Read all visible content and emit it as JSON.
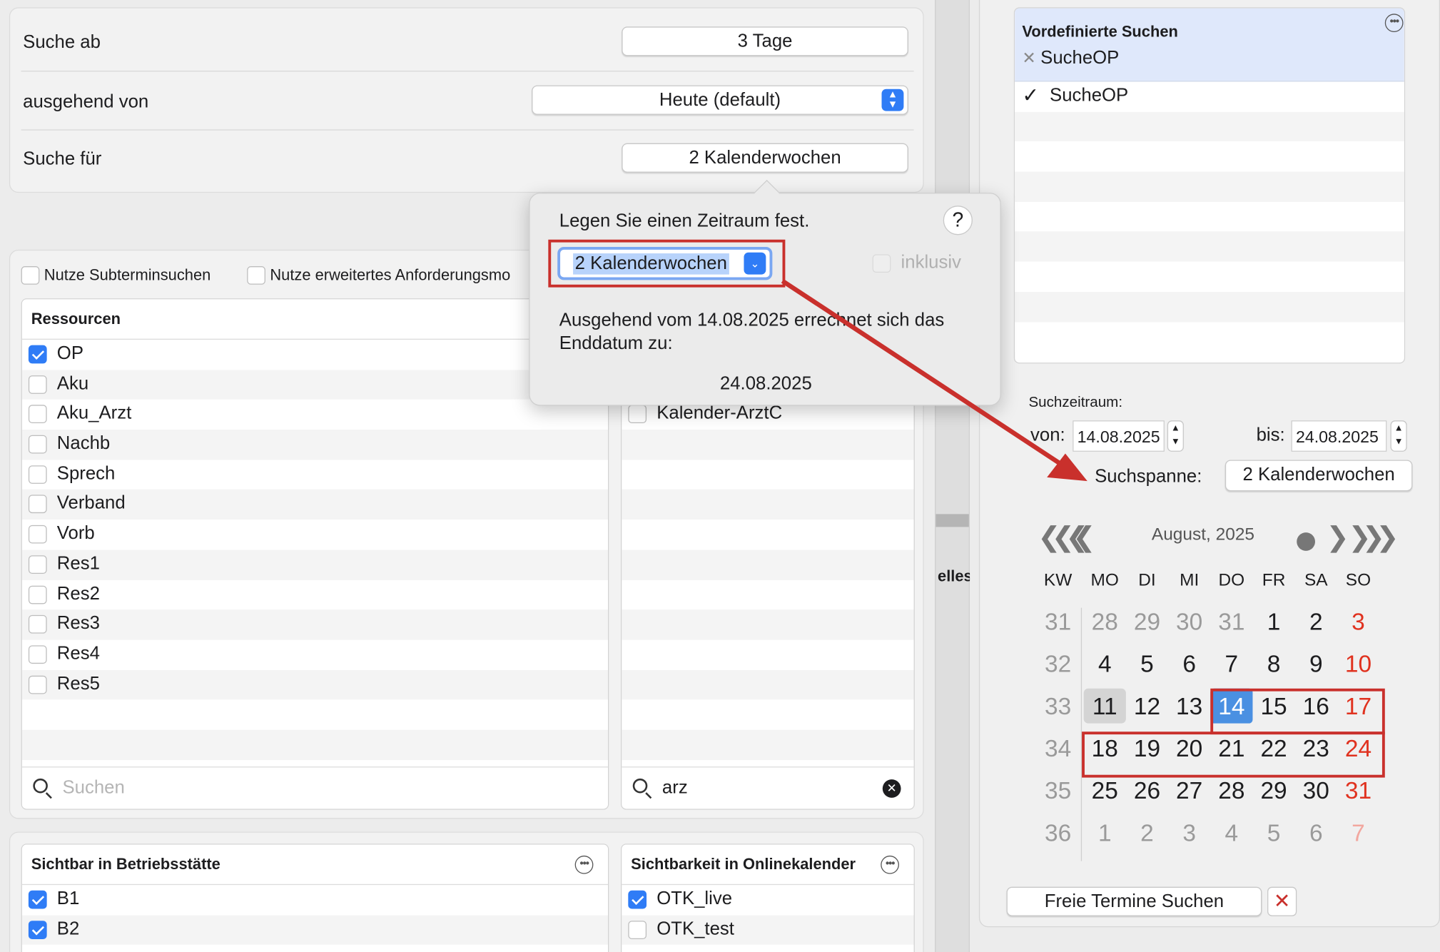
{
  "search_settings": {
    "search_from_label": "Suche ab",
    "search_from_value": "3 Tage",
    "based_on_label": "ausgehend von",
    "based_on_value": "Heute (default)",
    "search_for_label": "Suche für",
    "search_for_value": "2 Kalenderwochen"
  },
  "options": {
    "use_subterm": "Nutze Subterminsuchen",
    "use_extended": "Nutze erweitertes Anforderungsmo"
  },
  "resources": {
    "header": "Ressourcen",
    "items": [
      {
        "label": "OP",
        "checked": true
      },
      {
        "label": "Aku",
        "checked": false
      },
      {
        "label": "Aku_Arzt",
        "checked": false
      },
      {
        "label": "Nachb",
        "checked": false
      },
      {
        "label": "Sprech",
        "checked": false
      },
      {
        "label": "Verband",
        "checked": false
      },
      {
        "label": "Vorb",
        "checked": false
      },
      {
        "label": "Res1",
        "checked": false
      },
      {
        "label": "Res2",
        "checked": false
      },
      {
        "label": "Res3",
        "checked": false
      },
      {
        "label": "Res4",
        "checked": false
      },
      {
        "label": "Res5",
        "checked": false
      }
    ],
    "search_placeholder": "Suchen"
  },
  "second_list": {
    "visible_item": "Kalender-ArztC",
    "search_value": "arz"
  },
  "popover": {
    "title": "Legen Sie einen Zeitraum fest.",
    "help": "?",
    "selected": "2 Kalenderwochen",
    "inclusive": "inklusiv",
    "description": "Ausgehend vom 14.08.2025 errechnet sich das Enddatum zu:",
    "end_date": "24.08.2025"
  },
  "visible_in_site": {
    "header": "Sichtbar in Betriebsstätte",
    "items": [
      {
        "label": "B1",
        "checked": true
      },
      {
        "label": "B2",
        "checked": true
      }
    ]
  },
  "online_calendar": {
    "header": "Sichtbarkeit in Onlinekalender",
    "items": [
      {
        "label": "OTK_live",
        "checked": true
      },
      {
        "label": "OTK_test",
        "checked": false
      }
    ]
  },
  "partial_label": "elles",
  "predefined": {
    "header": "Vordefinierte Suchen",
    "active": "SucheOP",
    "items": [
      {
        "label": "SucheOP",
        "checked": true
      }
    ]
  },
  "timeframe": {
    "label": "Suchzeitraum:",
    "from_label": "von:",
    "from_value": "14.08.2025",
    "to_label": "bis:",
    "to_value": "24.08.2025",
    "span_label": "Suchspanne:",
    "span_value": "2 Kalenderwochen"
  },
  "calendar": {
    "month": "August, 2025",
    "headers": [
      "KW",
      "MO",
      "DI",
      "MI",
      "DO",
      "FR",
      "SA",
      "SO"
    ],
    "weeks": [
      {
        "kw": "31",
        "days": [
          "28",
          "29",
          "30",
          "31",
          "1",
          "2",
          "3"
        ]
      },
      {
        "kw": "32",
        "days": [
          "4",
          "5",
          "6",
          "7",
          "8",
          "9",
          "10"
        ]
      },
      {
        "kw": "33",
        "days": [
          "11",
          "12",
          "13",
          "14",
          "15",
          "16",
          "17"
        ]
      },
      {
        "kw": "34",
        "days": [
          "18",
          "19",
          "20",
          "21",
          "22",
          "23",
          "24"
        ]
      },
      {
        "kw": "35",
        "days": [
          "25",
          "26",
          "27",
          "28",
          "29",
          "30",
          "31"
        ]
      },
      {
        "kw": "36",
        "days": [
          "1",
          "2",
          "3",
          "4",
          "5",
          "6",
          "7"
        ]
      }
    ]
  },
  "actions": {
    "search_button": "Freie Termine Suchen",
    "cancel": "✕"
  },
  "colors": {
    "accent": "#2f7cf6",
    "highlight_red": "#c9302c",
    "sunday_red": "#e0321f"
  }
}
